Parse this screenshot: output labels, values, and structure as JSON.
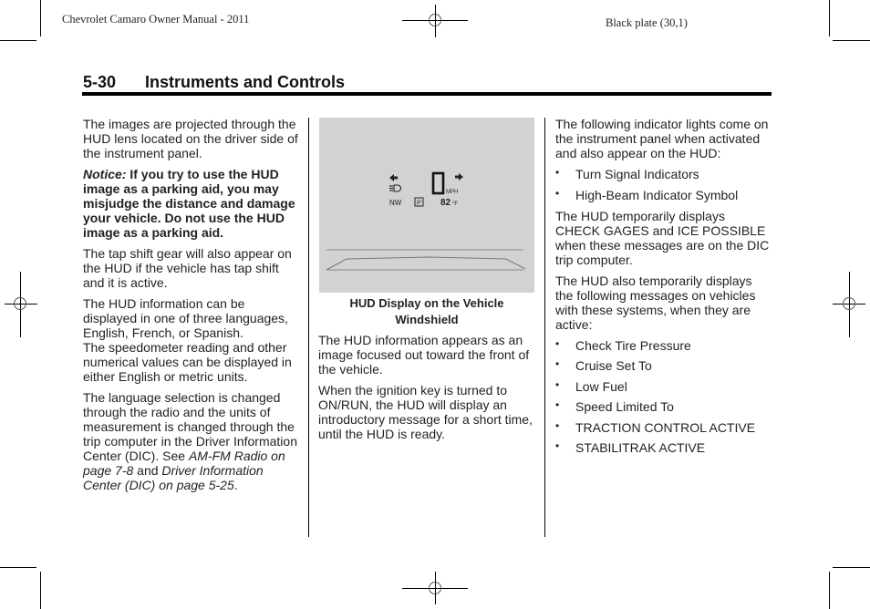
{
  "header": {
    "manual_title": "Chevrolet Camaro Owner Manual - 2011",
    "plate": "Black plate (30,1)"
  },
  "section": {
    "page_number": "5-30",
    "title": "Instruments and Controls"
  },
  "column1": {
    "p1": "The images are projected through the HUD lens located on the driver side of the instrument panel.",
    "notice_label": "Notice:",
    "notice_text": " If you try to use the HUD image as a parking aid, you may misjudge the distance and damage your vehicle. Do not use the HUD image as a parking aid.",
    "p3": "The tap shift gear will also appear on the HUD if the vehicle has tap shift and it is active.",
    "p4a": "The HUD information can be displayed in one of three languages, English, French, or Spanish.",
    "p4b": "The speedometer reading and other numerical values can be displayed in either English or metric units.",
    "p5_text": "The language selection is changed through the radio and the units of measurement is changed through the trip computer in the Driver Information Center (DIC). See ",
    "p5_link1": "AM-FM Radio on page 7-8",
    "p5_and": " and ",
    "p5_link2": "Driver Information Center (DIC) on page 5-25",
    "p5_end": "."
  },
  "column2": {
    "hud_image": {
      "speed": "0",
      "speed_unit": "MPH",
      "compass": "NW",
      "gear": "P",
      "temperature": "82",
      "temp_unit": "°F",
      "left_arrow_icon": "turn-left-arrow",
      "right_arrow_icon": "turn-right-arrow",
      "high_beam_icon": "high-beam"
    },
    "caption": "HUD Display on the Vehicle Windshield",
    "p1": "The HUD information appears as an image focused out toward the front of the vehicle.",
    "p2": "When the ignition key is turned to ON/RUN, the HUD will display an introductory message for a short time, until the HUD is ready."
  },
  "column3": {
    "p1": "The following indicator lights come on the instrument panel when activated and also appear on the HUD:",
    "list1": [
      "Turn Signal Indicators",
      "High-Beam Indicator Symbol"
    ],
    "p2": "The HUD temporarily displays CHECK GAGES and ICE POSSIBLE when these messages are on the DIC trip computer.",
    "p3": "The HUD also temporarily displays the following messages on vehicles with these systems, when they are active:",
    "list2": [
      "Check Tire Pressure",
      "Cruise Set To",
      "Low Fuel",
      "Speed Limited To",
      "TRACTION CONTROL ACTIVE",
      "STABILITRAK ACTIVE"
    ],
    "bullet": "•"
  }
}
